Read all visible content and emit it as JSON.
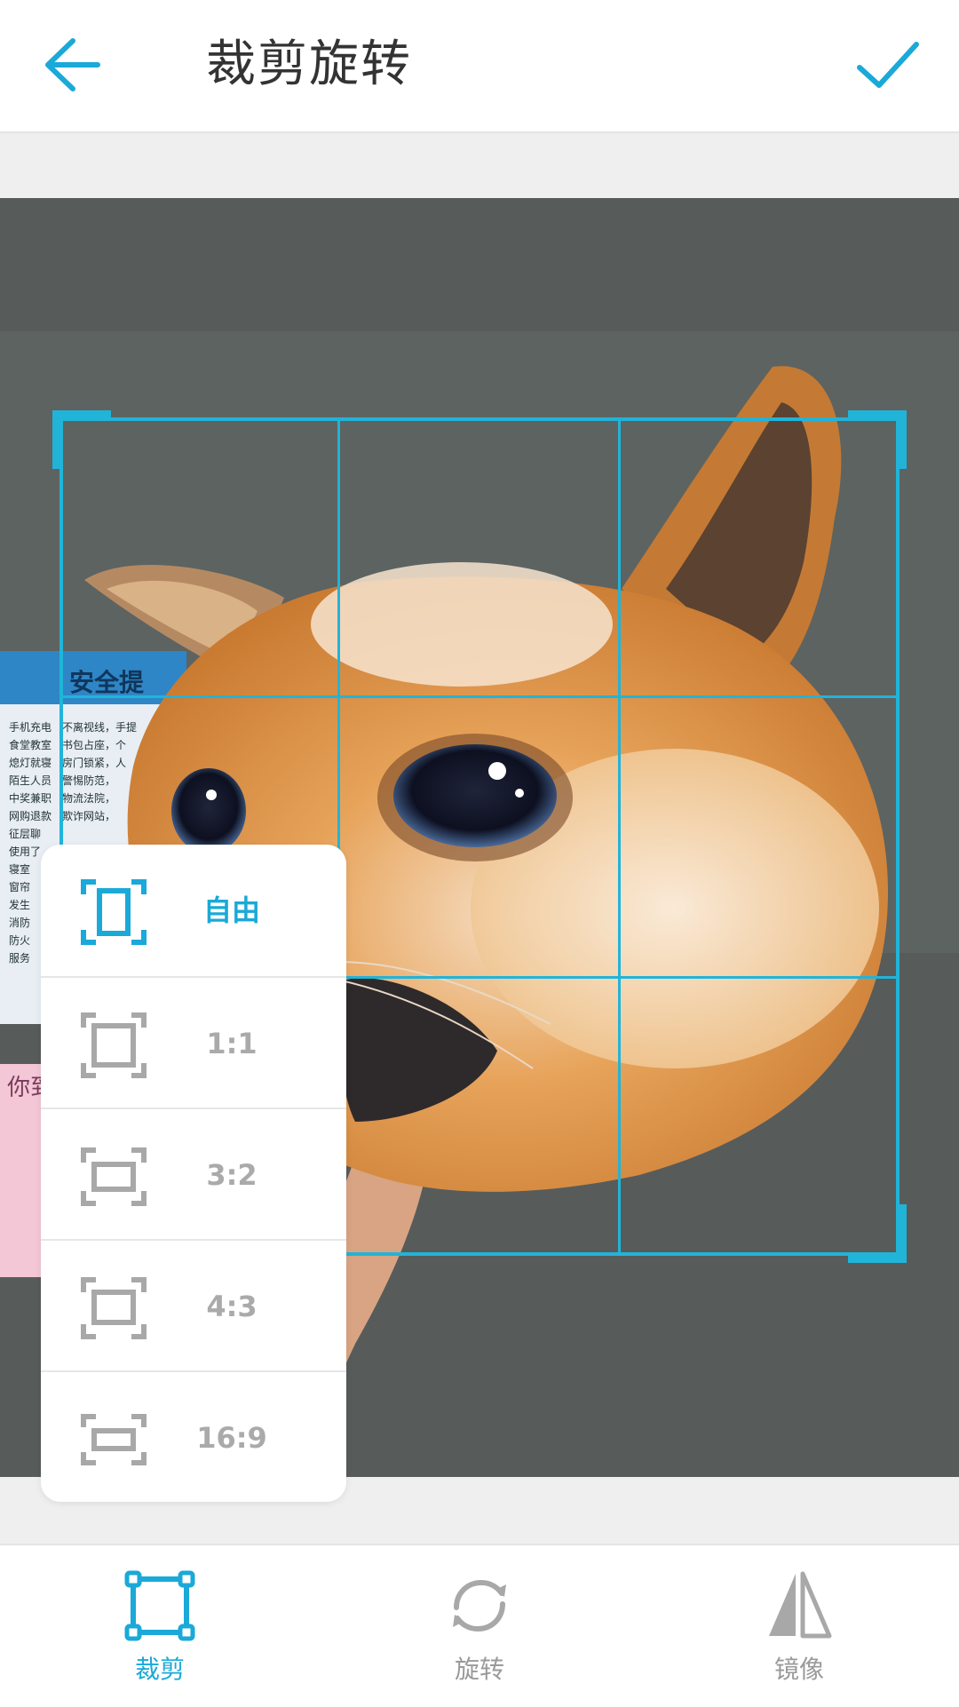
{
  "header": {
    "title": "裁剪旋转",
    "back_icon": "back-arrow-icon",
    "confirm_icon": "checkmark-icon"
  },
  "colors": {
    "accent": "#1aa9d8",
    "crop_line": "#21b4d9",
    "inactive": "#a8a8a8"
  },
  "ratio_menu": {
    "items": [
      {
        "label": "自由",
        "icon": "free-crop-icon",
        "active": true
      },
      {
        "label": "1:1",
        "icon": "ratio-1-1-icon",
        "active": false
      },
      {
        "label": "3:2",
        "icon": "ratio-3-2-icon",
        "active": false
      },
      {
        "label": "4:3",
        "icon": "ratio-4-3-icon",
        "active": false
      },
      {
        "label": "16:9",
        "icon": "ratio-16-9-icon",
        "active": false
      }
    ]
  },
  "toolbar": {
    "items": [
      {
        "label": "裁剪",
        "icon": "crop-icon",
        "active": true
      },
      {
        "label": "旋转",
        "icon": "rotate-icon",
        "active": false
      },
      {
        "label": "镜像",
        "icon": "mirror-icon",
        "active": false
      }
    ]
  },
  "photo": {
    "poster_title": "安全提",
    "poster_lines": [
      "手机充电",
      "食堂教室",
      "熄灯就寝",
      "陌生人员",
      "中奖兼职",
      "网购退款",
      "征层聊",
      "使用了",
      "寝室",
      "窗帘",
      "发生",
      "消防",
      "防火",
      "服务"
    ],
    "poster_right": [
      "不离视线，手提",
      "书包占座，个",
      "房门锁紧，人",
      "警惕防范，",
      "物流法院，",
      "欺诈网站，"
    ],
    "poster2": "你到"
  }
}
